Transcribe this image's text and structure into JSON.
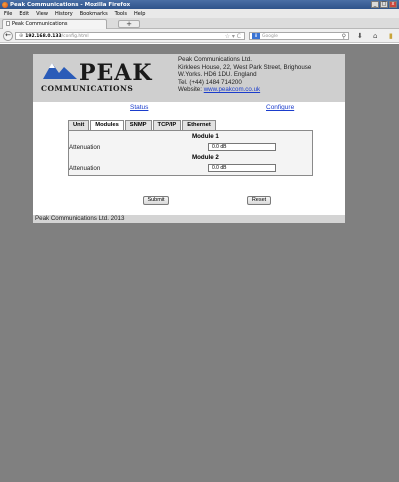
{
  "window": {
    "title": "Peak Communications - Mozilla Firefox",
    "minimize_label": "_",
    "maximize_label": "□",
    "close_label": "x"
  },
  "menu": [
    "File",
    "Edit",
    "View",
    "History",
    "Bookmarks",
    "Tools",
    "Help"
  ],
  "browser_tab": {
    "title": "Peak Communications",
    "new_tab_label": "+"
  },
  "nav": {
    "back_label": "←",
    "url_host": "192.168.0.133",
    "url_path": "/config.html",
    "star_label": "☆ ▾ C",
    "search_engine_badge": "8",
    "search_placeholder": "Google",
    "search_icon": "magnifier-icon",
    "download_icon": "⬇",
    "home_icon": "⌂",
    "bookmark_icon": "▮"
  },
  "header": {
    "logo_top": "PEAK",
    "logo_bottom": "COMMUNICATIONS",
    "company": "Peak Communications Ltd.",
    "address1": "Kirklees House, 22, West Park Street, Brighouse",
    "address2": "W.Yorks. HD6 1DU. England",
    "tel": "Tel. (+44) 1484 714200",
    "website_label": "Website:",
    "website_url": "www.peakcom.co.uk"
  },
  "topnav": {
    "status": "Status",
    "configure": "Configure"
  },
  "tabs": [
    "Unit",
    "Modules",
    "SNMP",
    "TCP/IP",
    "Ethernet"
  ],
  "modules": [
    {
      "title": "Module 1",
      "label": "Attenuation",
      "value": "0.0 dB"
    },
    {
      "title": "Module 2",
      "label": "Attenuation",
      "value": "0.0 dB"
    }
  ],
  "buttons": {
    "submit": "Submit",
    "reset": "Reset"
  },
  "footer": "Peak Communications Ltd. 2013",
  "colors": {
    "link": "#1a3ccc",
    "header_bg": "#cfcfcf",
    "viewport_bg": "#808080"
  }
}
